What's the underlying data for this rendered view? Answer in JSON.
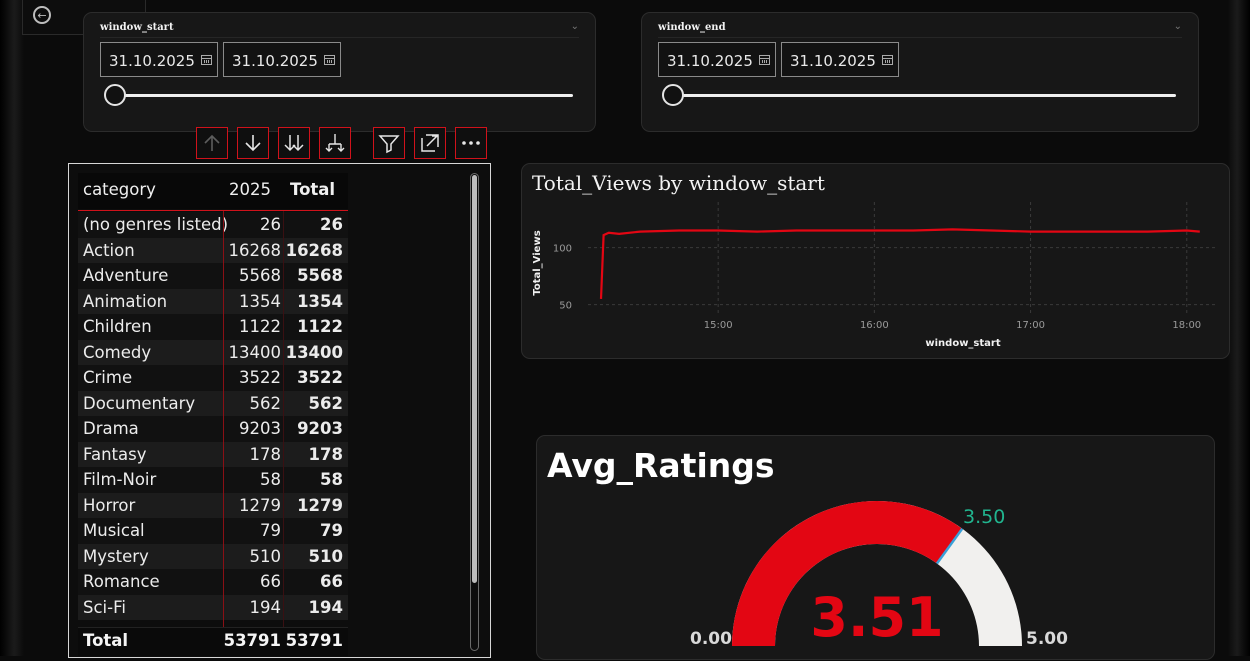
{
  "slicers": [
    {
      "title": "window_start",
      "from": "31.10.2025",
      "to": "31.10.2025"
    },
    {
      "title": "window_end",
      "from": "31.10.2025",
      "to": "31.10.2025"
    }
  ],
  "toolbar": {
    "icons": [
      "arrow-up-icon",
      "arrow-down-icon",
      "double-arrow-down-icon",
      "expand-hierarchy-icon",
      "filter-icon",
      "focus-mode-icon",
      "more-options-icon"
    ]
  },
  "table": {
    "headers": {
      "category": "category",
      "year": "2025",
      "total": "Total"
    },
    "rows": [
      {
        "category": "(no genres listed)",
        "year": "26",
        "total": "26"
      },
      {
        "category": "Action",
        "year": "16268",
        "total": "16268"
      },
      {
        "category": "Adventure",
        "year": "5568",
        "total": "5568"
      },
      {
        "category": "Animation",
        "year": "1354",
        "total": "1354"
      },
      {
        "category": "Children",
        "year": "1122",
        "total": "1122"
      },
      {
        "category": "Comedy",
        "year": "13400",
        "total": "13400"
      },
      {
        "category": "Crime",
        "year": "3522",
        "total": "3522"
      },
      {
        "category": "Documentary",
        "year": "562",
        "total": "562"
      },
      {
        "category": "Drama",
        "year": "9203",
        "total": "9203"
      },
      {
        "category": "Fantasy",
        "year": "178",
        "total": "178"
      },
      {
        "category": "Film-Noir",
        "year": "58",
        "total": "58"
      },
      {
        "category": "Horror",
        "year": "1279",
        "total": "1279"
      },
      {
        "category": "Musical",
        "year": "79",
        "total": "79"
      },
      {
        "category": "Mystery",
        "year": "510",
        "total": "510"
      },
      {
        "category": "Romance",
        "year": "66",
        "total": "66"
      },
      {
        "category": "Sci-Fi",
        "year": "194",
        "total": "194"
      }
    ],
    "total_row": {
      "label": "Total",
      "year": "53791",
      "total": "53791"
    }
  },
  "line_chart": {
    "title": "Total_Views by window_start",
    "xlabel": "window_start",
    "ylabel": "Total_Views",
    "line_color": "#e30613"
  },
  "chart_data": [
    {
      "type": "line",
      "title": "Total_Views by window_start",
      "xlabel": "window_start",
      "ylabel": "Total_Views",
      "x_ticks": [
        "15:00",
        "16:00",
        "17:00",
        "18:00"
      ],
      "y_ticks": [
        50,
        100
      ],
      "ylim": [
        40,
        140
      ],
      "grid": true,
      "series": [
        {
          "x": [
            "14:15",
            "14:16",
            "14:18",
            "14:22",
            "14:30",
            "14:45",
            "15:00",
            "15:15",
            "15:30",
            "15:45",
            "16:00",
            "16:15",
            "16:30",
            "16:45",
            "17:00",
            "17:15",
            "17:30",
            "17:45",
            "18:00",
            "18:05"
          ],
          "values": [
            55,
            111,
            113,
            112,
            114,
            115,
            115,
            114,
            115,
            115,
            115,
            115,
            116,
            115,
            114,
            114,
            114,
            114,
            115,
            114
          ]
        }
      ]
    },
    {
      "type": "gauge",
      "title": "Avg_Ratings",
      "value": 3.51,
      "min": 0,
      "max": 5,
      "target": 3.5
    }
  ],
  "gauge": {
    "title": "Avg_Ratings",
    "value_label": "3.51",
    "min_label": "0.00",
    "max_label": "5.00",
    "target_label": "3.50",
    "value": 3.51,
    "min": 0,
    "max": 5,
    "target": 3.5,
    "fill_color": "#e30613",
    "track_color": "#f1f0ee",
    "target_color": "#3aa0d8"
  }
}
